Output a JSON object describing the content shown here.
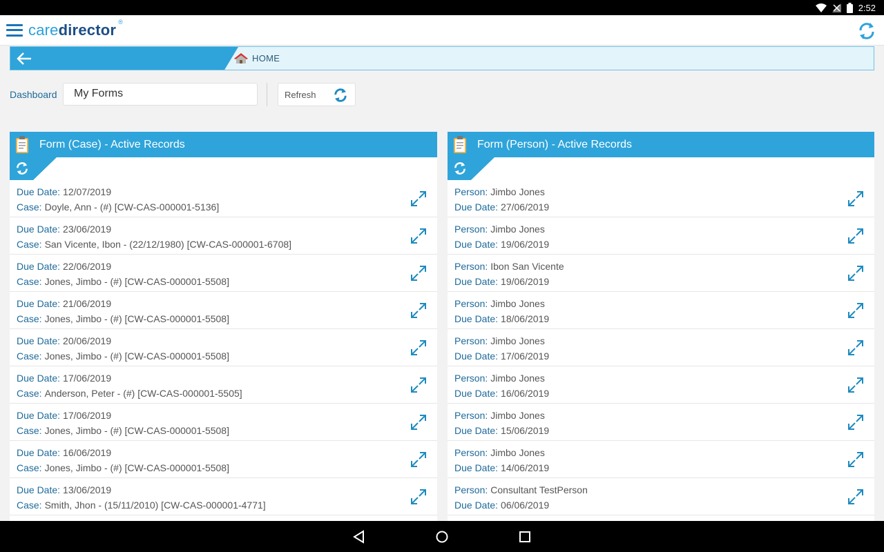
{
  "statusbar": {
    "time": "2:52"
  },
  "app": {
    "logo_care": "care",
    "logo_director": "director",
    "logo_reg": "®"
  },
  "breadcrumb": {
    "home_label": "HOME"
  },
  "dashboard": {
    "label": "Dashboard",
    "selected": "My Forms",
    "refresh_label": "Refresh"
  },
  "colors": {
    "primary": "#2ea4da",
    "label": "#1d6a9a",
    "brand_dark": "#1d4e86"
  },
  "panels": [
    {
      "title": "Form (Case) - Active Records",
      "rows": [
        {
          "l1": "Due Date:",
          "v1": "12/07/2019",
          "l2": "Case:",
          "v2": "Doyle, Ann - (#) [CW-CAS-000001-5136]"
        },
        {
          "l1": "Due Date:",
          "v1": "23/06/2019",
          "l2": "Case:",
          "v2": "San Vicente, Ibon - (22/12/1980) [CW-CAS-000001-6708]"
        },
        {
          "l1": "Due Date:",
          "v1": "22/06/2019",
          "l2": "Case:",
          "v2": "Jones, Jimbo - (#) [CW-CAS-000001-5508]"
        },
        {
          "l1": "Due Date:",
          "v1": "21/06/2019",
          "l2": "Case:",
          "v2": "Jones, Jimbo - (#) [CW-CAS-000001-5508]"
        },
        {
          "l1": "Due Date:",
          "v1": "20/06/2019",
          "l2": "Case:",
          "v2": "Jones, Jimbo - (#) [CW-CAS-000001-5508]"
        },
        {
          "l1": "Due Date:",
          "v1": "17/06/2019",
          "l2": "Case:",
          "v2": "Anderson, Peter - (#) [CW-CAS-000001-5505]"
        },
        {
          "l1": "Due Date:",
          "v1": "17/06/2019",
          "l2": "Case:",
          "v2": "Jones, Jimbo - (#) [CW-CAS-000001-5508]"
        },
        {
          "l1": "Due Date:",
          "v1": "16/06/2019",
          "l2": "Case:",
          "v2": "Jones, Jimbo - (#) [CW-CAS-000001-5508]"
        },
        {
          "l1": "Due Date:",
          "v1": "13/06/2019",
          "l2": "Case:",
          "v2": "Smith, Jhon - (15/11/2010) [CW-CAS-000001-4771]"
        }
      ]
    },
    {
      "title": "Form (Person) - Active Records",
      "rows": [
        {
          "l1": "Person:",
          "v1": "Jimbo Jones",
          "l2": "Due Date:",
          "v2": "27/06/2019"
        },
        {
          "l1": "Person:",
          "v1": "Jimbo Jones",
          "l2": "Due Date:",
          "v2": "19/06/2019"
        },
        {
          "l1": "Person:",
          "v1": "Ibon San Vicente",
          "l2": "Due Date:",
          "v2": "19/06/2019"
        },
        {
          "l1": "Person:",
          "v1": "Jimbo Jones",
          "l2": "Due Date:",
          "v2": "18/06/2019"
        },
        {
          "l1": "Person:",
          "v1": "Jimbo Jones",
          "l2": "Due Date:",
          "v2": "17/06/2019"
        },
        {
          "l1": "Person:",
          "v1": "Jimbo Jones",
          "l2": "Due Date:",
          "v2": "16/06/2019"
        },
        {
          "l1": "Person:",
          "v1": "Jimbo Jones",
          "l2": "Due Date:",
          "v2": "15/06/2019"
        },
        {
          "l1": "Person:",
          "v1": "Jimbo Jones",
          "l2": "Due Date:",
          "v2": "14/06/2019"
        },
        {
          "l1": "Person:",
          "v1": "Consultant TestPerson",
          "l2": "Due Date:",
          "v2": "06/06/2019"
        }
      ]
    }
  ]
}
